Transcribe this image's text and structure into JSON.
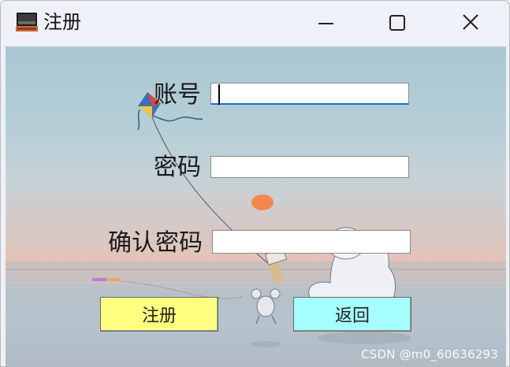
{
  "window": {
    "title": "注册",
    "icon": "app-window-icon",
    "controls": {
      "minimize": "minimize-icon",
      "maximize": "maximize-icon",
      "close": "close-icon"
    }
  },
  "form": {
    "account_label": "账号",
    "account_value": "",
    "password_label": "密码",
    "password_value": "",
    "confirm_label": "确认密码",
    "confirm_value": ""
  },
  "buttons": {
    "register": "注册",
    "back": "返回"
  },
  "colors": {
    "register_button": "#ffff80",
    "back_button": "#a6ffff",
    "focus_underline": "#1f6fc6"
  },
  "watermark": "CSDN @m0_60636293"
}
